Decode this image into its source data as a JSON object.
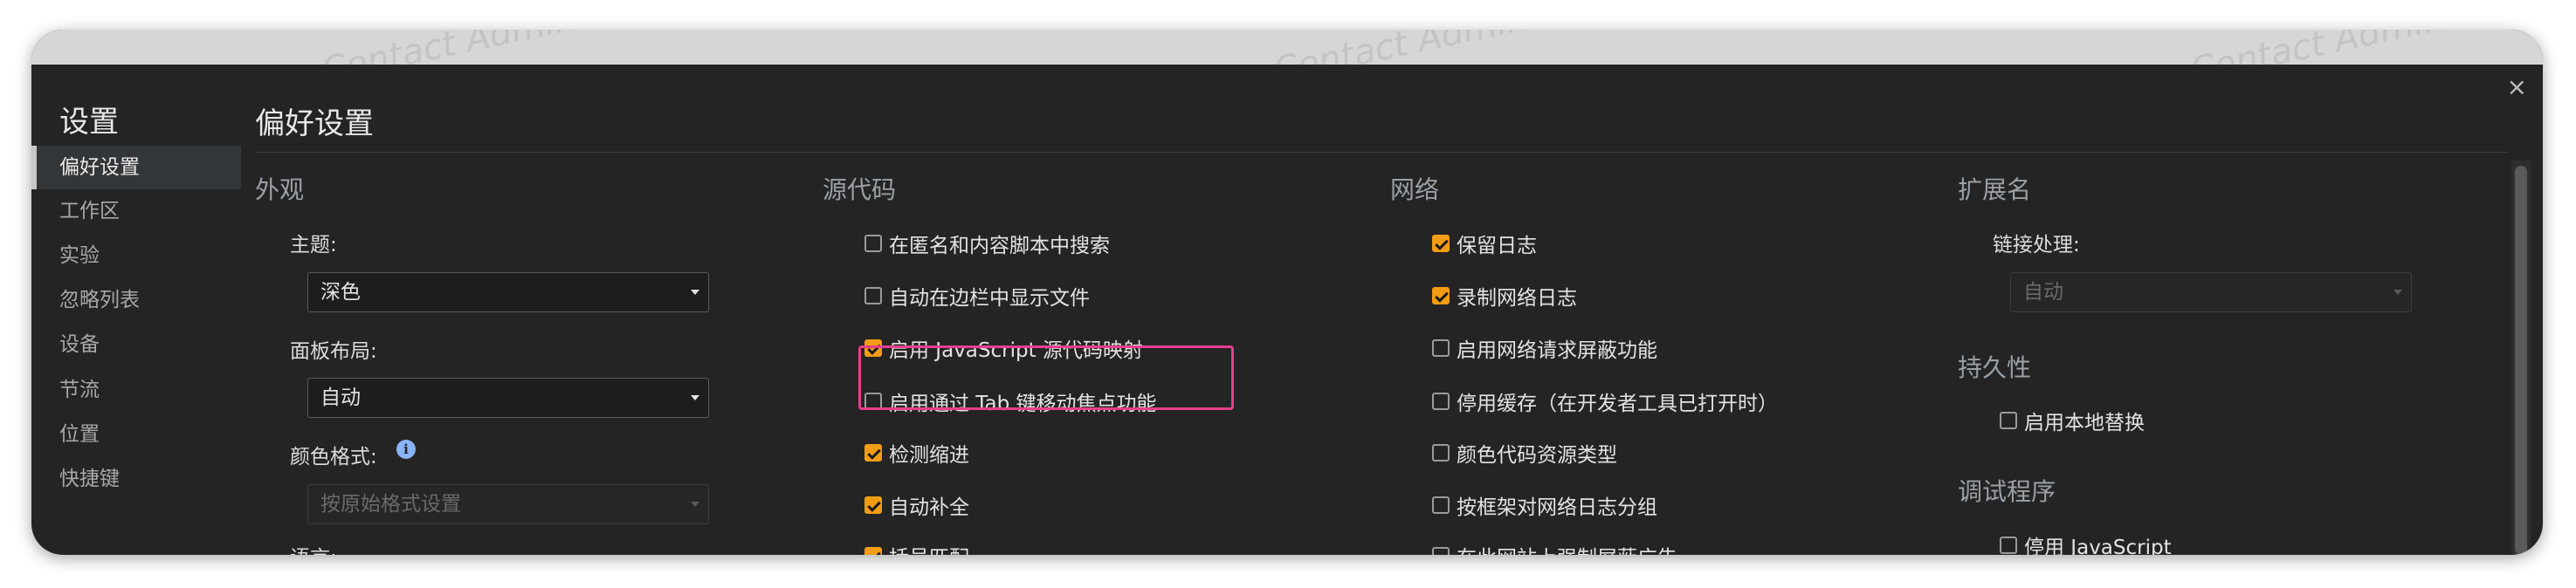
{
  "watermark": "Contact Admin",
  "close_icon": "×",
  "sidebar": {
    "title": "设置",
    "items": [
      {
        "label": "偏好设置",
        "active": true
      },
      {
        "label": "工作区"
      },
      {
        "label": "实验"
      },
      {
        "label": "忽略列表"
      },
      {
        "label": "设备"
      },
      {
        "label": "节流"
      },
      {
        "label": "位置"
      },
      {
        "label": "快捷键"
      }
    ]
  },
  "main": {
    "title": "偏好设置",
    "appearance": {
      "title": "外观",
      "theme_label": "主题:",
      "theme_value": "深色",
      "layout_label": "面板布局:",
      "layout_value": "自动",
      "color_format_label": "颜色格式:",
      "color_format_value": "按原始格式设置",
      "language_label": "语言:"
    },
    "sources": {
      "title": "源代码",
      "options": [
        {
          "label": "在匿名和内容脚本中搜索",
          "checked": false
        },
        {
          "label": "自动在边栏中显示文件",
          "checked": false
        },
        {
          "label": "启用 JavaScript 源代码映射",
          "checked": true
        },
        {
          "label": "启用通过 Tab 键移动焦点功能",
          "checked": false
        },
        {
          "label": "检测缩进",
          "checked": true
        },
        {
          "label": "自动补全",
          "checked": true
        },
        {
          "label": "括号匹配",
          "checked": true
        }
      ]
    },
    "network": {
      "title": "网络",
      "options": [
        {
          "label": "保留日志",
          "checked": true
        },
        {
          "label": "录制网络日志",
          "checked": true
        },
        {
          "label": "启用网络请求屏蔽功能",
          "checked": false
        },
        {
          "label": "停用缓存（在开发者工具已打开时）",
          "checked": false
        },
        {
          "label": "颜色代码资源类型",
          "checked": false
        },
        {
          "label": "按框架对网络日志分组",
          "checked": false
        },
        {
          "label": "在此网站上强制屏蔽广告",
          "checked": false
        }
      ]
    },
    "extensions": {
      "title": "扩展名",
      "link_label": "链接处理:",
      "link_value": "自动"
    },
    "persistence": {
      "title": "持久性",
      "local_overrides": {
        "label": "启用本地替换",
        "checked": false
      }
    },
    "debugger": {
      "title": "调试程序",
      "disable_js": {
        "label": "停用 JavaScript",
        "checked": false
      }
    }
  },
  "colors": {
    "accent": "#f29d15",
    "highlight": "#e83e8c",
    "info": "#8ab4f8"
  }
}
